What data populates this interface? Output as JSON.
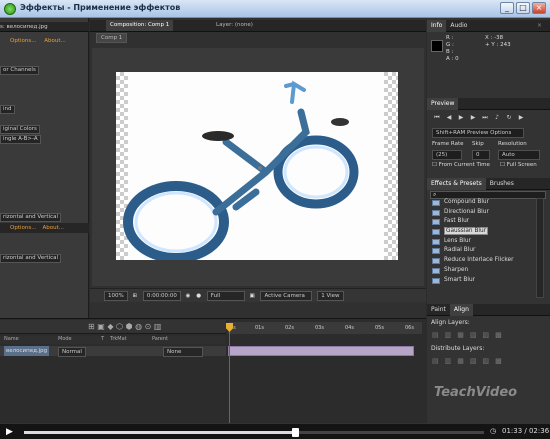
{
  "window": {
    "title": "Эффекты - Применение эффектов"
  },
  "left_panel": {
    "layer_name": "s: велосипед.jpg",
    "options_link": "Options...",
    "about_link": "About...",
    "rows": [
      "or Channels",
      "ind",
      "iginal Colors",
      "ingle A-B>-A",
      "rizontal and Vertical",
      "rizontal and Vertical"
    ]
  },
  "comp_panel": {
    "tab": "Composition: Comp 1",
    "layer_tab": "Layer: (none)",
    "sub_tab": "Comp 1",
    "footer": {
      "zoom": "100%",
      "timecode": "0:00:00:00",
      "resolution": "Full",
      "camera": "Active Camera",
      "view": "1 View"
    }
  },
  "info_panel": {
    "tabs": [
      "Info",
      "Audio"
    ],
    "r": "R :",
    "g": "G :",
    "b": "B :",
    "a": "A : 0",
    "x": "X : -38",
    "y": "+ Y : 243"
  },
  "preview_panel": {
    "title": "Preview",
    "ram_preview": "Shift+RAM Preview Options",
    "frame_rate_label": "Frame Rate",
    "skip_label": "Skip",
    "resolution_label": "Resolution",
    "frame_rate": "(25)",
    "skip": "0",
    "resolution": "Auto",
    "from_current": "From Current Time",
    "full_screen": "Full Screen"
  },
  "effects_panel": {
    "tabs": [
      "Effects & Presets",
      "Brushes"
    ],
    "search_placeholder": "",
    "items": [
      "Compound Blur",
      "Directional Blur",
      "Fast Blur",
      "Gaussian Blur",
      "Lens Blur",
      "Radial Blur",
      "Reduce Interlace Flicker",
      "Sharpen",
      "Smart Blur"
    ]
  },
  "align_panel": {
    "tabs": [
      "Paint",
      "Align"
    ],
    "align_layers": "Align Layers:",
    "distribute_layers": "Distribute Layers:"
  },
  "timeline": {
    "col_name": "Name",
    "col_mode": "Mode",
    "col_t": "T",
    "col_trkmat": "TrkMat",
    "col_parent": "Parent",
    "layer_name": "велосипед.jpg",
    "layer_mode": "Normal",
    "layer_parent": "None",
    "ticks": [
      "0s",
      "01s",
      "02s",
      "03s",
      "04s",
      "05s",
      "06s"
    ]
  },
  "player": {
    "time": "01:33 / 02:36",
    "progress": 0.59
  },
  "watermark": "TeachVideo",
  "colors": {
    "accent": "#e8a03a",
    "playhead": "#dd3333",
    "layer_bar": "#b6a5c6"
  }
}
